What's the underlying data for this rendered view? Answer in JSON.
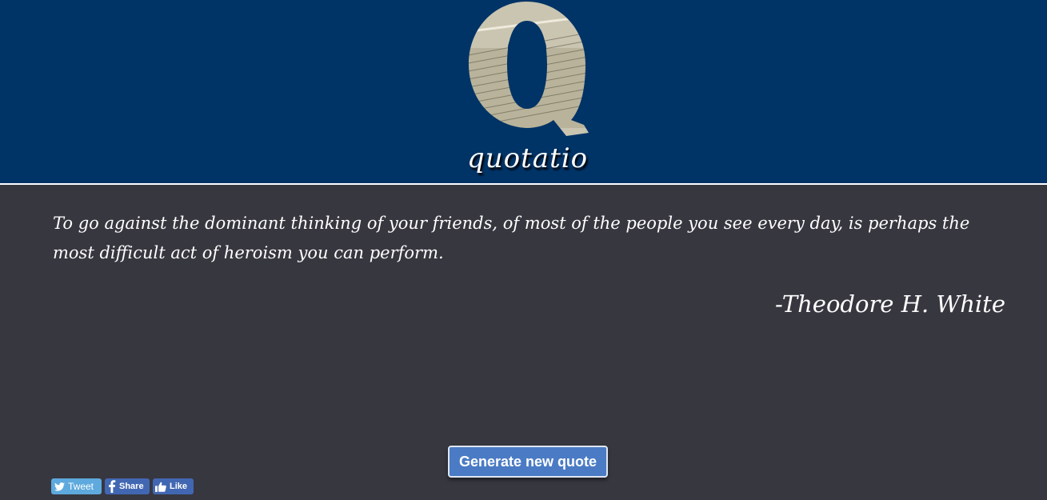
{
  "header": {
    "logo_text": "quotatio",
    "logo_letter": "Q"
  },
  "quote": {
    "text": "To go against the dominant thinking of your friends, of most of the people you see every day, is perhaps the most difficult act of heroism you can perform.",
    "author": "-Theodore H. White"
  },
  "actions": {
    "generate_label": "Generate new quote"
  },
  "social": {
    "tweet_label": "Tweet",
    "share_label": "Share",
    "like_label": "Like"
  },
  "colors": {
    "header_bg": "#003366",
    "body_bg": "#373740",
    "button_bg": "#4a7bc4",
    "twitter": "#5ea9dd",
    "facebook": "#4267b2"
  },
  "icons": [
    "quotatio-logo-icon",
    "twitter-bird-icon",
    "facebook-icon",
    "thumbs-up-icon"
  ]
}
